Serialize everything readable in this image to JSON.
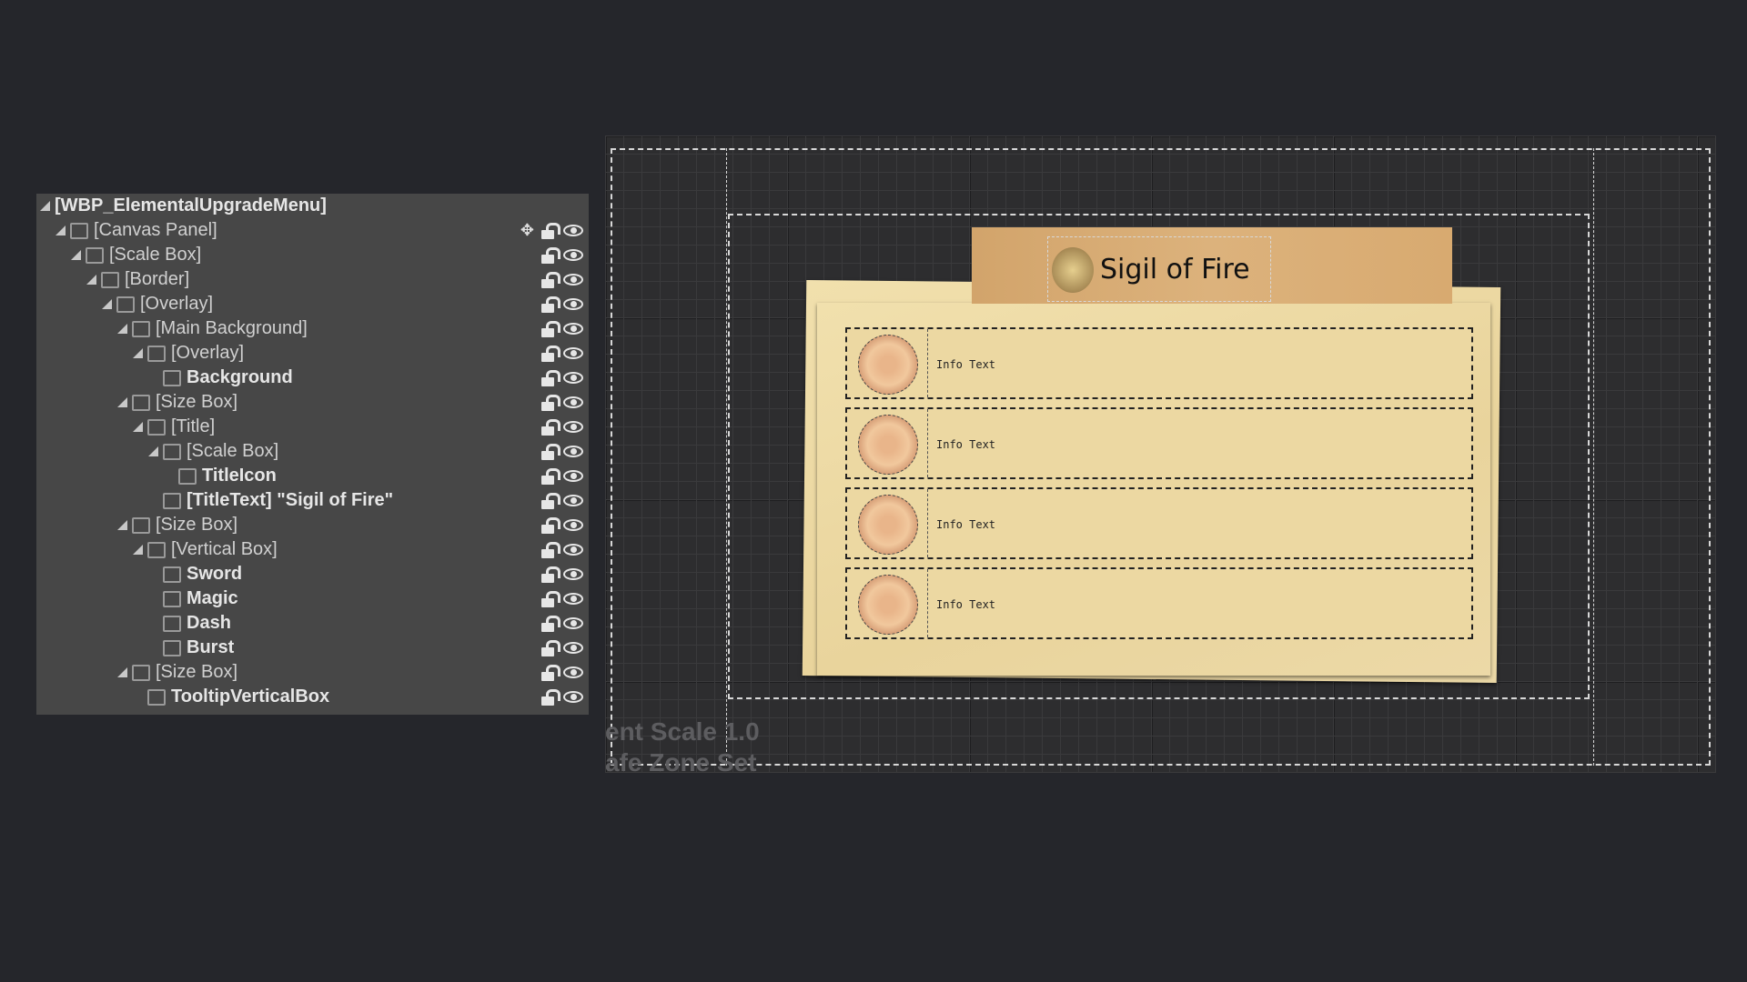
{
  "hierarchy": {
    "items": [
      {
        "label": "[WBP_ElementalUpgradeMenu]",
        "depth": 0,
        "bold": true,
        "icon": "none"
      },
      {
        "label": "[Canvas Panel]",
        "depth": 1,
        "icon": "canvas-panel-icon"
      },
      {
        "label": "[Scale Box]",
        "depth": 2,
        "icon": "scale-box-icon"
      },
      {
        "label": "[Border]",
        "depth": 3,
        "icon": "border-icon"
      },
      {
        "label": "[Overlay]",
        "depth": 4,
        "icon": "overlay-icon"
      },
      {
        "label": "[Main Background]",
        "depth": 5,
        "icon": "scale-box-icon"
      },
      {
        "label": "[Overlay]",
        "depth": 6,
        "icon": "overlay-icon"
      },
      {
        "label": "Background",
        "depth": 7,
        "bold": true,
        "icon": "image-icon"
      },
      {
        "label": "[Size Box]",
        "depth": 5,
        "icon": "size-box-icon"
      },
      {
        "label": "[Title]",
        "depth": 6,
        "icon": "horizontal-box-icon"
      },
      {
        "label": "[Scale Box]",
        "depth": 7,
        "icon": "scale-box-icon"
      },
      {
        "label": "TitleIcon",
        "depth": 8,
        "bold": true,
        "icon": "image-icon",
        "locked": true
      },
      {
        "label": "[TitleText] \"Sigil of Fire\"",
        "depth": 7,
        "bold": true,
        "icon": "text-icon"
      },
      {
        "label": "[Size Box]",
        "depth": 5,
        "icon": "size-box-icon"
      },
      {
        "label": "[Vertical Box]",
        "depth": 6,
        "icon": "vertical-box-icon"
      },
      {
        "label": "Sword",
        "depth": 7,
        "bold": true,
        "icon": "user-widget-icon"
      },
      {
        "label": "Magic",
        "depth": 7,
        "bold": true,
        "icon": "user-widget-icon"
      },
      {
        "label": "Dash",
        "depth": 7,
        "bold": true,
        "icon": "user-widget-icon"
      },
      {
        "label": "Burst",
        "depth": 7,
        "bold": true,
        "icon": "user-widget-icon"
      },
      {
        "label": "[Size Box]",
        "depth": 5,
        "icon": "size-box-icon"
      },
      {
        "label": "TooltipVerticalBox",
        "depth": 6,
        "bold": true,
        "icon": "vertical-box-icon"
      }
    ]
  },
  "preview": {
    "title": "Sigil of Fire",
    "entries": [
      "Info Text",
      "Info Text",
      "Info Text",
      "Info Text"
    ],
    "dpi_text": "ent Scale 1.0",
    "safe_zone_text": "afe Zone Set"
  }
}
